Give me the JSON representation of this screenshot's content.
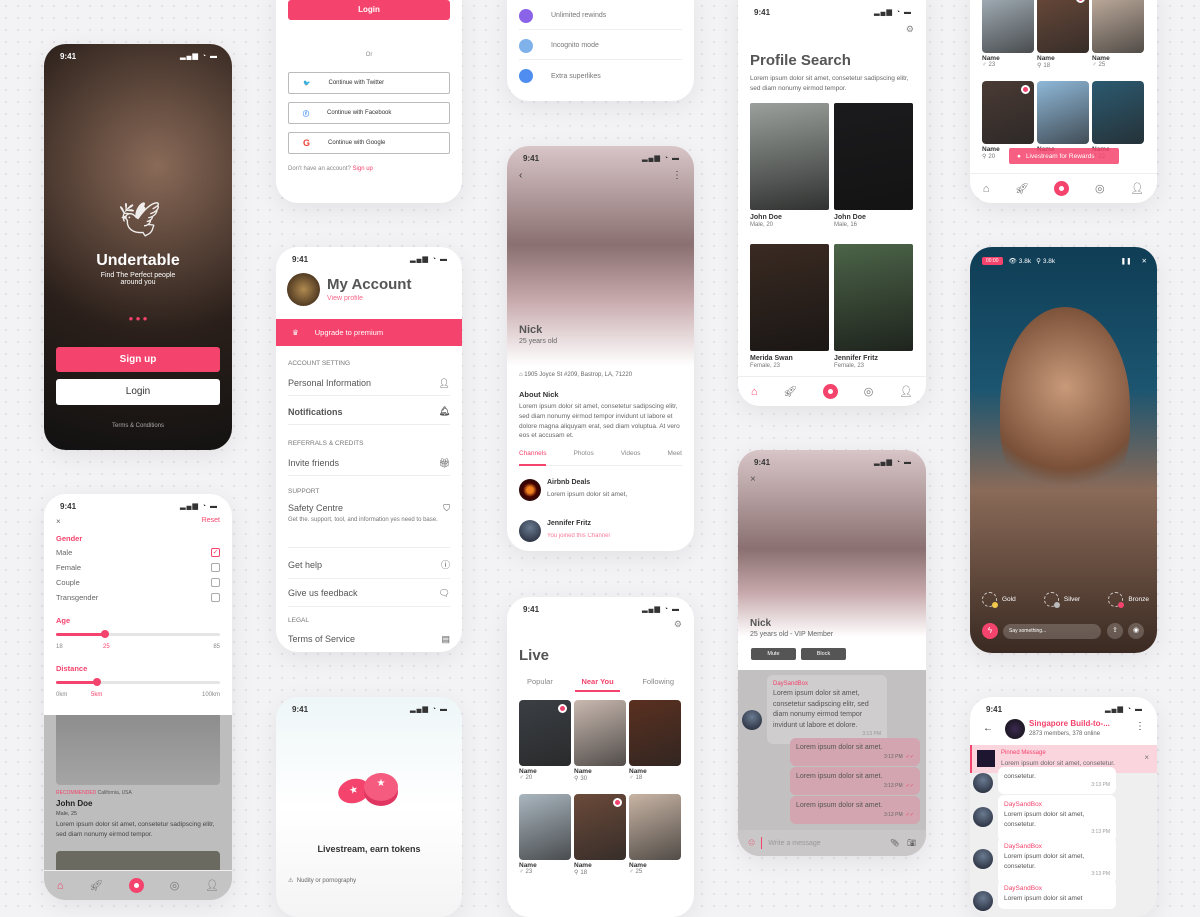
{
  "status_time": "9:41",
  "colors": {
    "accent": "#f4436c"
  },
  "splash": {
    "app_name": "Undertable",
    "tagline": "Find The Perfect people around you",
    "signup": "Sign up",
    "login": "Login",
    "terms": "Terms & Conditions"
  },
  "login": {
    "login": "Login",
    "or": "Or",
    "twitter": "Continue with Twitter",
    "facebook": "Continue with Facebook",
    "google": "Continue with Google",
    "no_account": "Don't have an account?",
    "signup": "Sign up"
  },
  "premium": {
    "features": [
      {
        "label": "Unlimited rewinds",
        "icon": "rewind-icon",
        "color": "#8a63e8"
      },
      {
        "label": "Incognito mode",
        "icon": "lock-icon",
        "color": "#7fb2ea"
      },
      {
        "label": "Extra superlikes",
        "icon": "star-icon",
        "color": "#4f8ef0"
      }
    ]
  },
  "profile": {
    "name": "Nick",
    "age": "25 years old",
    "address": "1905 Joyce St #209, Bastrop, LA, 71220",
    "about_title": "About Nick",
    "about": "Lorem ipsum dolor sit amet, consetetur sadipscing elitr, sed diam nonumy eirmod tempor invidunt ut labore et dolore magna aliquyam erat, sed diam voluptua. At vero eos et accusam et.",
    "tabs": [
      "Channels",
      "Photos",
      "Videos",
      "Meet"
    ],
    "active_tab": "Channels",
    "channels": [
      {
        "name": "Airbnb Deals",
        "sub": "Lorem ipsum dolor sit amet,"
      },
      {
        "name": "Jennifer Fritz",
        "sub": "You joined this Channel"
      }
    ]
  },
  "account": {
    "title": "My Account",
    "view_profile": "View profile",
    "upgrade": "Upgrade to premium",
    "sections": {
      "account": "ACCOUNT SETTING",
      "referrals": "REFERRALS & CREDITS",
      "support": "SUPPORT",
      "legal": "LEGAL"
    },
    "personal": "Personal Information",
    "notifications": "Notifications",
    "invite": "Invite friends",
    "safety": "Safety Centre",
    "safety_desc": "Get the. support, tool, and information yes need to base.",
    "help": "Get help",
    "feedback": "Give us feedback",
    "terms": "Terms of Service"
  },
  "filter": {
    "reset": "Reset",
    "gender_title": "Gender",
    "genders": [
      {
        "label": "Male",
        "checked": true
      },
      {
        "label": "Female",
        "checked": false
      },
      {
        "label": "Couple",
        "checked": false
      },
      {
        "label": "Transgender",
        "checked": false
      }
    ],
    "age_title": "Age",
    "age_min": "18",
    "age_value": "25",
    "age_max": "85",
    "age_fraction": 0.3,
    "distance_title": "Distance",
    "dist_min": "0km",
    "dist_value": "5km",
    "dist_max": "100km",
    "dist_fraction": 0.25,
    "recommended": "RECOMMENDED",
    "location": "California, USA",
    "person": "John Doe",
    "meta": "Male, 25",
    "desc": "Lorem ipsum dolor sit amet, consetetur sadipscing elitr, sed diam nonumy eirmod tempor."
  },
  "tokens": {
    "title": "Livestream, earn tokens",
    "item": "Nudity or pornography"
  },
  "live": {
    "title": "Live",
    "tabs": [
      "Popular",
      "Near You",
      "Following"
    ],
    "active_tab": "Near You",
    "cards": [
      {
        "name": "Name",
        "sym": "♂",
        "age": "20",
        "live": true,
        "c": "#3b3f44"
      },
      {
        "name": "Name",
        "sym": "⚲",
        "age": "30",
        "live": false,
        "c": "#c9b9b0"
      },
      {
        "name": "Name",
        "sym": "♂",
        "age": "18",
        "live": false,
        "c": "#5a3020"
      },
      {
        "name": "Name",
        "sym": "♂",
        "age": "23",
        "live": false,
        "c": "#aab6bf"
      },
      {
        "name": "Name",
        "sym": "⚲",
        "age": "18",
        "live": true,
        "c": "#6b4a3a"
      },
      {
        "name": "Name",
        "sym": "♂",
        "age": "25",
        "live": false,
        "c": "#c8b4a4"
      }
    ]
  },
  "search": {
    "title": "Profile Search",
    "desc": "Lorem ipsum dolor sit amet, consetetur sadipscing elitr, sed diam nonumy eirmod tempor.",
    "people": [
      {
        "name": "John Doe",
        "meta": "Male, 20",
        "c": "#9aa09c"
      },
      {
        "name": "John Doe",
        "meta": "Male, 16",
        "c": "#1b1b1d"
      },
      {
        "name": "Merida Swan",
        "meta": "Female, 23",
        "c": "#3a2a22"
      },
      {
        "name": "Jennifer Fritz",
        "meta": "Female, 23",
        "c": "#4c6448"
      }
    ]
  },
  "chat": {
    "name": "Nick",
    "sub": "25 years old - VIP Member",
    "mute": "Mute",
    "block": "Block",
    "incoming": {
      "sender": "DaySandBox",
      "text": "Lorem ipsum dolor sit amet, consetetur sadipscing elitr, sed diam nonumy eirmod tempor invidunt ut labore et dolore.",
      "time": "3:13 PM"
    },
    "outgoing": [
      {
        "text": "Lorem ipsum dolor sit amet.",
        "time": "3:13 PM"
      },
      {
        "text": "Lorem ipsum dolor sit amet.",
        "time": "3:13 PM"
      },
      {
        "text": "Lorem ipsum dolor sit amet.",
        "time": "3:13 PM"
      }
    ],
    "placeholder": "Write a message"
  },
  "grid_top": {
    "banner": "Livestream for Rewards",
    "cards": [
      {
        "name": "Name",
        "sym": "♂",
        "age": "23",
        "live": false,
        "c": "#aab6bf"
      },
      {
        "name": "Name",
        "sym": "⚲",
        "age": "18",
        "live": true,
        "c": "#6b4a3a"
      },
      {
        "name": "Name",
        "sym": "♂",
        "age": "25",
        "live": false,
        "c": "#c8b4a4"
      },
      {
        "name": "Name",
        "sym": "⚲",
        "age": "20",
        "live": true,
        "c": "#4a3a34"
      },
      {
        "name": "Name",
        "sym": "⚲",
        "age": "19",
        "live": false,
        "c": "#8fb8d8"
      },
      {
        "name": "Name",
        "sym": "⚲",
        "age": "22",
        "live": false,
        "c": "#2c5a70"
      }
    ]
  },
  "stream": {
    "timer": "00:00",
    "views": "3.8k",
    "signal": "3.8k",
    "gifts": [
      {
        "label": "Gold",
        "color": "#f2c94c"
      },
      {
        "label": "Silver",
        "color": "#bbbbbb"
      },
      {
        "label": "Bronze",
        "color": "#f4436c"
      }
    ],
    "placeholder": "Say something..."
  },
  "group": {
    "name": "Singapore Build-to-...",
    "members": "2873 members, 378 online",
    "pinned_title": "Pinned Message",
    "pinned_text": "Lorem ipsum dolor sit amet, consetetur.",
    "messages": [
      {
        "sender": "",
        "text": "consetetur.",
        "time": "3:13 PM"
      },
      {
        "sender": "DaySandBox",
        "text": "Lorem ipsum dolor sit amet, consetetur.",
        "time": "3:13 PM"
      },
      {
        "sender": "DaySandBox",
        "text": "Lorem ipsum dolor sit amet, consetetur.",
        "time": "3:13 PM"
      },
      {
        "sender": "DaySandBox",
        "text": "Lorem ipsum dolor sit amet",
        "time": ""
      }
    ]
  }
}
